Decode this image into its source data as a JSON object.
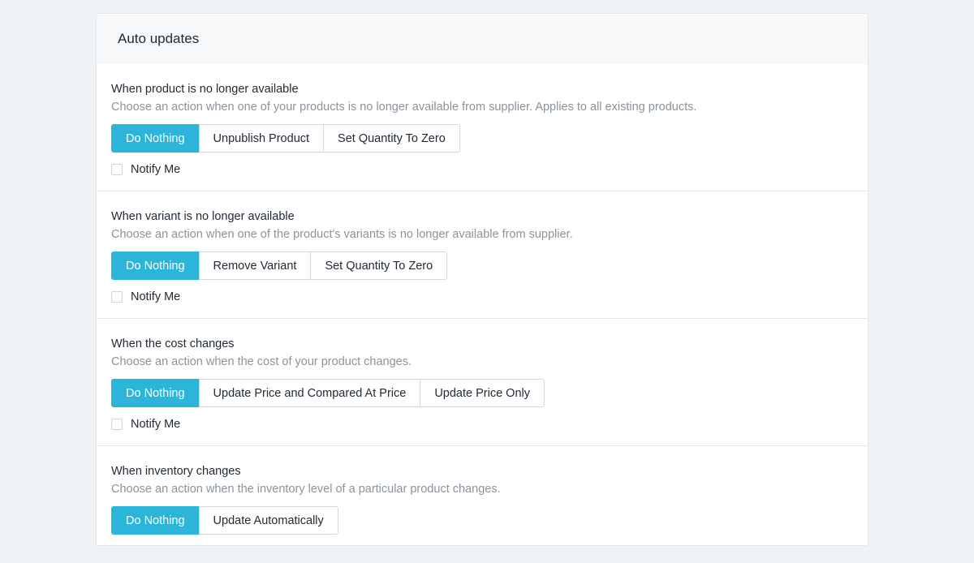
{
  "card": {
    "title": "Auto updates"
  },
  "sections": [
    {
      "title": "When product is no longer available",
      "description": "Choose an action when one of your products is no longer available from supplier. Applies to all existing products.",
      "options": [
        "Do Nothing",
        "Unpublish Product",
        "Set Quantity To Zero"
      ],
      "selected": "Do Nothing",
      "notify_label": "Notify Me",
      "notify_checked": false
    },
    {
      "title": "When variant is no longer available",
      "description": "Choose an action when one of the product's variants is no longer available from supplier.",
      "options": [
        "Do Nothing",
        "Remove Variant",
        "Set Quantity To Zero"
      ],
      "selected": "Do Nothing",
      "notify_label": "Notify Me",
      "notify_checked": false
    },
    {
      "title": "When the cost changes",
      "description": "Choose an action when the cost of your product changes.",
      "options": [
        "Do Nothing",
        "Update Price and Compared At Price",
        "Update Price Only"
      ],
      "selected": "Do Nothing",
      "notify_label": "Notify Me",
      "notify_checked": false
    },
    {
      "title": "When inventory changes",
      "description": "Choose an action when the inventory level of a particular product changes.",
      "options": [
        "Do Nothing",
        "Update Automatically"
      ],
      "selected": "Do Nothing"
    }
  ],
  "colors": {
    "accent": "#2bb5d8",
    "page_background": "#f0f3f6",
    "muted_text": "#8a939c"
  }
}
